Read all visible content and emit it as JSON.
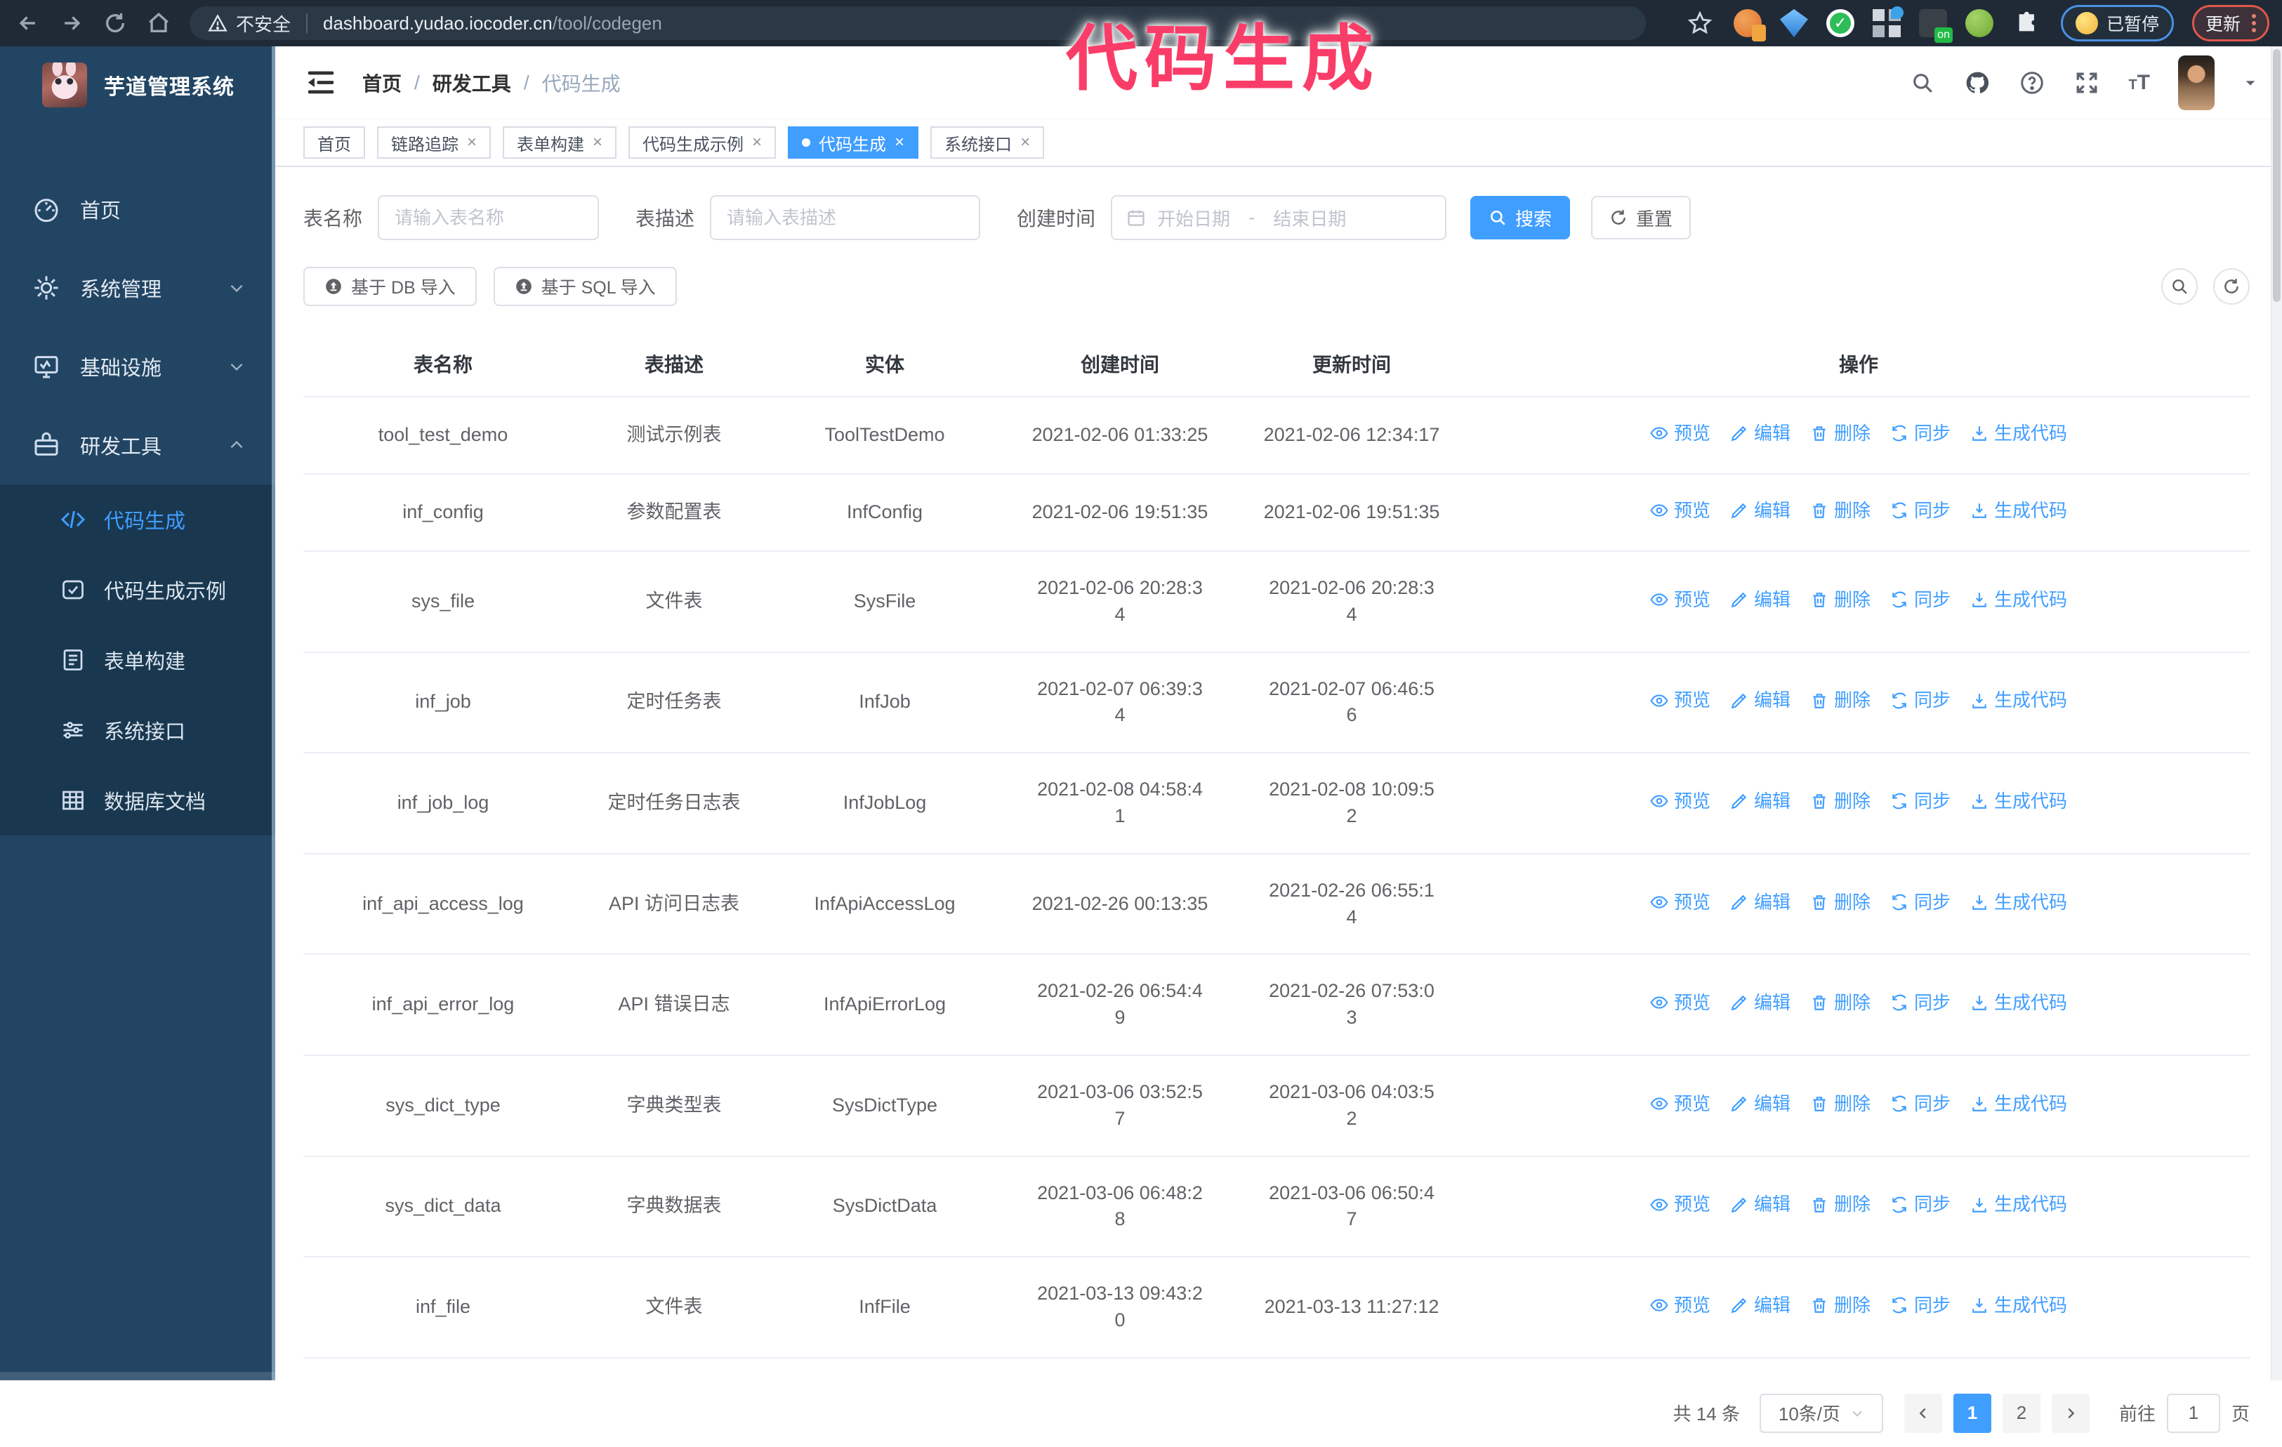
{
  "overlay": {
    "title": "代码生成",
    "color": "#fa3d68"
  },
  "browser": {
    "insecure_label": "不安全",
    "url_host": "dashboard.yudao.iocoder.cn",
    "url_path": "/tool/codegen",
    "paused_badge": "已暂停",
    "update_button": "更新"
  },
  "sidebar": {
    "logo_title": "芋道管理系统",
    "items": [
      {
        "label": "首页"
      },
      {
        "label": "系统管理"
      },
      {
        "label": "基础设施"
      },
      {
        "label": "研发工具"
      }
    ],
    "submenu": [
      {
        "label": "代码生成",
        "active": true
      },
      {
        "label": "代码生成示例"
      },
      {
        "label": "表单构建"
      },
      {
        "label": "系统接口"
      },
      {
        "label": "数据库文档"
      }
    ]
  },
  "header": {
    "breadcrumb": [
      "首页",
      "研发工具",
      "代码生成"
    ],
    "separator": "/"
  },
  "tags": [
    {
      "label": "首页",
      "closable": false,
      "active": false
    },
    {
      "label": "链路追踪",
      "closable": true,
      "active": false
    },
    {
      "label": "表单构建",
      "closable": true,
      "active": false
    },
    {
      "label": "代码生成示例",
      "closable": true,
      "active": false
    },
    {
      "label": "代码生成",
      "closable": true,
      "active": true
    },
    {
      "label": "系统接口",
      "closable": true,
      "active": false
    }
  ],
  "filters": {
    "table_name_label": "表名称",
    "table_name_placeholder": "请输入表名称",
    "table_desc_label": "表描述",
    "table_desc_placeholder": "请输入表描述",
    "create_time_label": "创建时间",
    "date_start_placeholder": "开始日期",
    "date_separator": "-",
    "date_end_placeholder": "结束日期",
    "search_button": "搜索",
    "reset_button": "重置"
  },
  "toolbar": {
    "import_db_button": "基于 DB 导入",
    "import_sql_button": "基于 SQL 导入"
  },
  "table": {
    "columns": [
      "表名称",
      "表描述",
      "实体",
      "创建时间",
      "更新时间",
      "操作"
    ],
    "row_actions": [
      "预览",
      "编辑",
      "删除",
      "同步",
      "生成代码"
    ],
    "rows": [
      {
        "name": "tool_test_demo",
        "desc": "测试示例表",
        "entity": "ToolTestDemo",
        "created": "2021-02-06 01:33:25",
        "updated": "2021-02-06 12:34:17"
      },
      {
        "name": "inf_config",
        "desc": "参数配置表",
        "entity": "InfConfig",
        "created": "2021-02-06 19:51:35",
        "updated": "2021-02-06 19:51:35"
      },
      {
        "name": "sys_file",
        "desc": "文件表",
        "entity": "SysFile",
        "created": "2021-02-06 20:28:3\n4",
        "updated": "2021-02-06 20:28:3\n4"
      },
      {
        "name": "inf_job",
        "desc": "定时任务表",
        "entity": "InfJob",
        "created": "2021-02-07 06:39:3\n4",
        "updated": "2021-02-07 06:46:5\n6"
      },
      {
        "name": "inf_job_log",
        "desc": "定时任务日志表",
        "entity": "InfJobLog",
        "created": "2021-02-08 04:58:4\n1",
        "updated": "2021-02-08 10:09:5\n2"
      },
      {
        "name": "inf_api_access_log",
        "desc": "API 访问日志表",
        "entity": "InfApiAccessLog",
        "created": "2021-02-26 00:13:35",
        "updated": "2021-02-26 06:55:1\n4"
      },
      {
        "name": "inf_api_error_log",
        "desc": "API 错误日志",
        "entity": "InfApiErrorLog",
        "created": "2021-02-26 06:54:4\n9",
        "updated": "2021-02-26 07:53:0\n3"
      },
      {
        "name": "sys_dict_type",
        "desc": "字典类型表",
        "entity": "SysDictType",
        "created": "2021-03-06 03:52:5\n7",
        "updated": "2021-03-06 04:03:5\n2"
      },
      {
        "name": "sys_dict_data",
        "desc": "字典数据表",
        "entity": "SysDictData",
        "created": "2021-03-06 06:48:2\n8",
        "updated": "2021-03-06 06:50:4\n7"
      },
      {
        "name": "inf_file",
        "desc": "文件表",
        "entity": "InfFile",
        "created": "2021-03-13 09:43:2\n0",
        "updated": "2021-03-13 11:27:12"
      }
    ]
  },
  "pagination": {
    "total_text": "共 14 条",
    "page_size": "10条/页",
    "pages": [
      "1",
      "2"
    ],
    "active_page": "1",
    "goto_label": "前往",
    "goto_value": "1",
    "goto_suffix": "页"
  },
  "colors": {
    "primary": "#409eff",
    "chrome_bg": "#1f2a36",
    "sidebar_bg": "#224563",
    "submenu_bg": "#193850",
    "overlay_pink": "#fa3d68"
  }
}
